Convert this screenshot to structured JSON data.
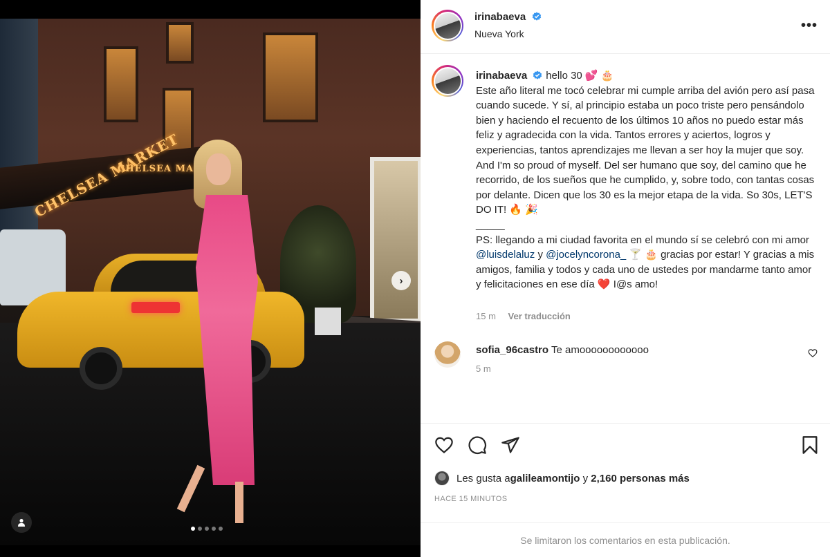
{
  "post": {
    "author": "irinabaeva",
    "location": "Nueva York",
    "more_label": "•••",
    "verified_color": "#3897f0",
    "carousel": {
      "total": 5,
      "current": 1,
      "next_icon": "chevron-right-icon"
    },
    "photo_signs": {
      "sign_1": "CHELSEA MARKET",
      "sign_2": "CHELSEA MARKET"
    }
  },
  "caption": {
    "username": "irinabaeva",
    "line_1": "hello 30 💕 🎂",
    "line_2": "Este año literal me tocó celebrar mi cumple arriba del avión pero así pasa cuando sucede. Y sí, al principio estaba un poco triste pero pensándolo bien y haciendo el recuento de los últimos 10 años no puedo estar más feliz y agradecida con la vida. Tantos errores y aciertos, logros y experiencias, tantos aprendizajes me llevan a ser hoy la mujer que soy. And I'm so proud of myself. Del ser humano que soy, del camino que he recorrido, de los sueños que he cumplido, y, sobre todo, con tantas cosas por delante. Dicen que los 30 es la mejor etapa de la vida. So 30s, LET'S DO IT! 🔥 🎉",
    "divider": "_____",
    "ps_start": "PS: llegando a mi ciudad favorita en el mundo sí se celebró con mi amor ",
    "mention_1": "@luisdelaluz",
    "ps_mid": " y ",
    "mention_2": "@jocelyncorona_",
    "ps_end": " 🍸 🎂 gracias por estar! Y gracias a mis amigos, familia y todos y cada uno de ustedes por mandarme tanto amor y felicitaciones en ese día ❤️ I@s amo!",
    "time": "15 m",
    "translate": "Ver traducción"
  },
  "comment": {
    "username": "sofia_96castro",
    "text": "Te amoooooooooooo",
    "time": "5 m"
  },
  "likes": {
    "prefix": "Les gusta a ",
    "user": "galileamontijo",
    "mid": " y ",
    "count": "2,160 personas más"
  },
  "timestamp": "HACE 15 MINUTOS",
  "footer_text": "Se limitaron los comentarios en esta publicación."
}
